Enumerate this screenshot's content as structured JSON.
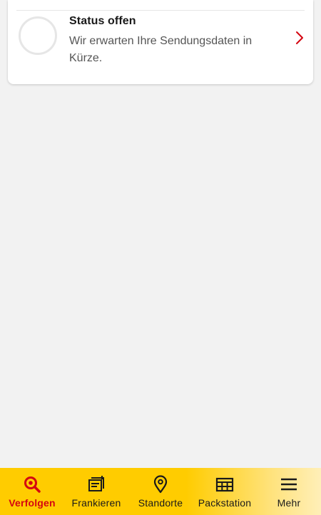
{
  "status": {
    "title": "Status offen",
    "description": "Wir erwarten Ihre Sendungsdaten in Kürze."
  },
  "tabs": [
    {
      "label": "Verfolgen",
      "icon": "search-icon",
      "active": true
    },
    {
      "label": "Frankieren",
      "icon": "stamp-icon",
      "active": false
    },
    {
      "label": "Standorte",
      "icon": "location-pin-icon",
      "active": false
    },
    {
      "label": "Packstation",
      "icon": "packstation-icon",
      "active": false
    },
    {
      "label": "Mehr",
      "icon": "menu-icon",
      "active": false
    }
  ],
  "colors": {
    "brand_yellow": "#ffcc00",
    "brand_red": "#d40511",
    "background": "#f2f2f2"
  }
}
